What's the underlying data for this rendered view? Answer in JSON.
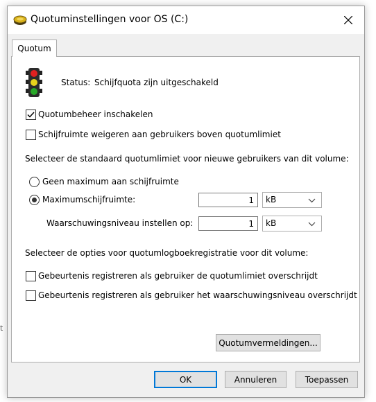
{
  "window": {
    "title": "Quotuminstellingen voor OS (C:)"
  },
  "tabs": [
    {
      "label": "Quotum"
    }
  ],
  "status": {
    "label": "Status:",
    "value": "Schijfquota zijn uitgeschakeld"
  },
  "options": {
    "enable_quota": {
      "label": "Quotumbeheer inschakelen",
      "checked": true
    },
    "deny_space": {
      "label": "Schijfruimte weigeren aan gebruikers boven quotumlimiet",
      "checked": false
    }
  },
  "default_limit": {
    "heading": "Selecteer de standaard quotumlimiet voor nieuwe gebruikers van dit volume:",
    "no_limit_label": "Geen maximum aan schijfruimte",
    "limit_label": "Maximumschijfruimte:",
    "limit_value": "1",
    "limit_unit": "kB",
    "warning_label": "Waarschuwingsniveau instellen op:",
    "warning_value": "1",
    "warning_unit": "kB"
  },
  "logging": {
    "heading": "Selecteer de opties voor quotumlogboekregistratie voor dit volume:",
    "log_limit_label": "Gebeurtenis registreren als gebruiker de quotumlimiet overschrijdt",
    "log_warning_label": "Gebeurtenis registreren als gebruiker het waarschuwingsniveau overschrijdt"
  },
  "quota_entries_button": "Quotumvermeldingen...",
  "buttons": {
    "ok": "OK",
    "cancel": "Annuleren",
    "apply": "Toepassen"
  },
  "background": {
    "stray_char": "t"
  },
  "icons": {
    "title": "drive-icon",
    "status": "traffic-light-icon",
    "close": "close-icon"
  }
}
